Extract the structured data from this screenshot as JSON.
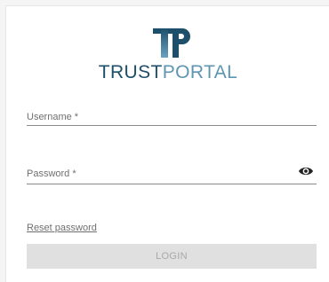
{
  "brand": {
    "name_part1": "TRUST",
    "name_part2": "PORTAL",
    "logo_icon": "tp-logo-icon"
  },
  "form": {
    "username_label": "Username *",
    "username_value": "",
    "password_label": "Password *",
    "password_value": "",
    "password_toggle_icon": "eye-icon",
    "reset_link": "Reset password",
    "login_button": "LOGIN"
  },
  "colors": {
    "brand_dark": "#1d4f6a",
    "brand_light": "#5e95b2",
    "button_disabled": "#e0e0e0"
  }
}
